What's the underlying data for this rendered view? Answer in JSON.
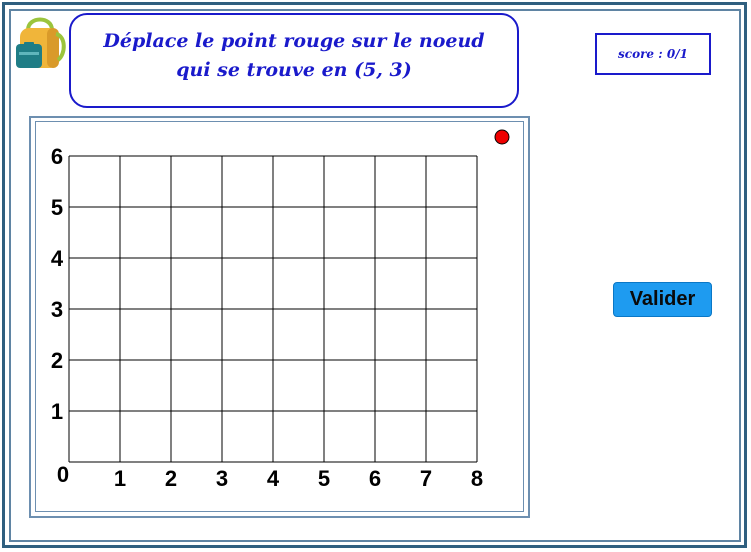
{
  "instruction": {
    "line1": "Déplace le point rouge sur le noeud",
    "line2": "qui se trouve en (5, 3)"
  },
  "score": {
    "text": "score : 0/1"
  },
  "grid": {
    "x_labels": [
      "0",
      "1",
      "2",
      "3",
      "4",
      "5",
      "6",
      "7",
      "8"
    ],
    "y_labels": [
      "1",
      "2",
      "3",
      "4",
      "5",
      "6"
    ],
    "columns": 8,
    "rows": 6
  },
  "target_node": {
    "x": 5,
    "y": 3
  },
  "red_point": {
    "color": "#ee0000"
  },
  "validate_button": {
    "label": "Valider",
    "color": "#1e9bf0"
  },
  "colors": {
    "accent_blue": "#1a1acb",
    "frame": "#2f5f7f"
  },
  "icons": {
    "logo": "backpack-icon"
  }
}
